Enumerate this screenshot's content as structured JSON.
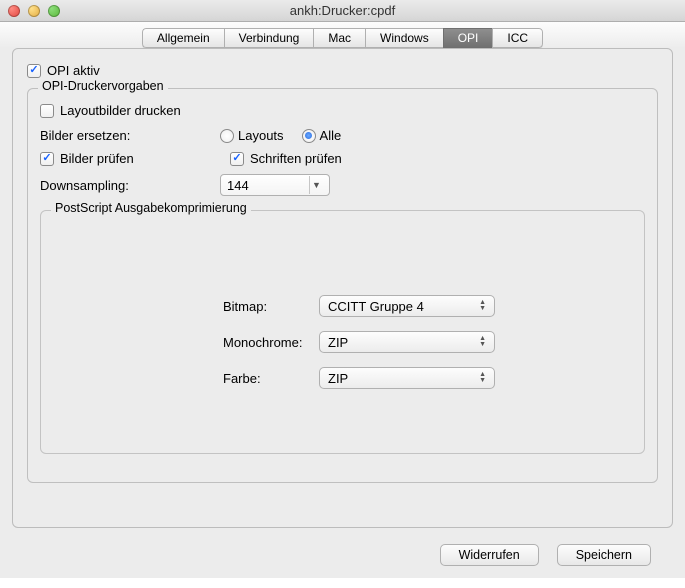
{
  "window": {
    "title": "ankh:Drucker:cpdf"
  },
  "tabs": {
    "t0": "Allgemein",
    "t1": "Verbindung",
    "t2": "Mac",
    "t3": "Windows",
    "t4": "OPI",
    "t5": "ICC"
  },
  "opi": {
    "aktiv_label": "OPI aktiv",
    "group_label": "OPI-Druckervorgaben",
    "layoutbilder_label": "Layoutbilder drucken",
    "bilder_ersetzen_label": "Bilder ersetzen:",
    "radio_layouts": "Layouts",
    "radio_alle": "Alle",
    "bilder_pruefen": "Bilder prüfen",
    "schriften_pruefen": "Schriften prüfen",
    "downsampling_label": "Downsampling:",
    "downsampling_value": "144"
  },
  "compress": {
    "group_label": "PostScript Ausgabekomprimierung",
    "bitmap_label": "Bitmap:",
    "bitmap_value": "CCITT Gruppe 4",
    "mono_label": "Monochrome:",
    "mono_value": "ZIP",
    "farbe_label": "Farbe:",
    "farbe_value": "ZIP"
  },
  "buttons": {
    "revert": "Widerrufen",
    "save": "Speichern"
  }
}
